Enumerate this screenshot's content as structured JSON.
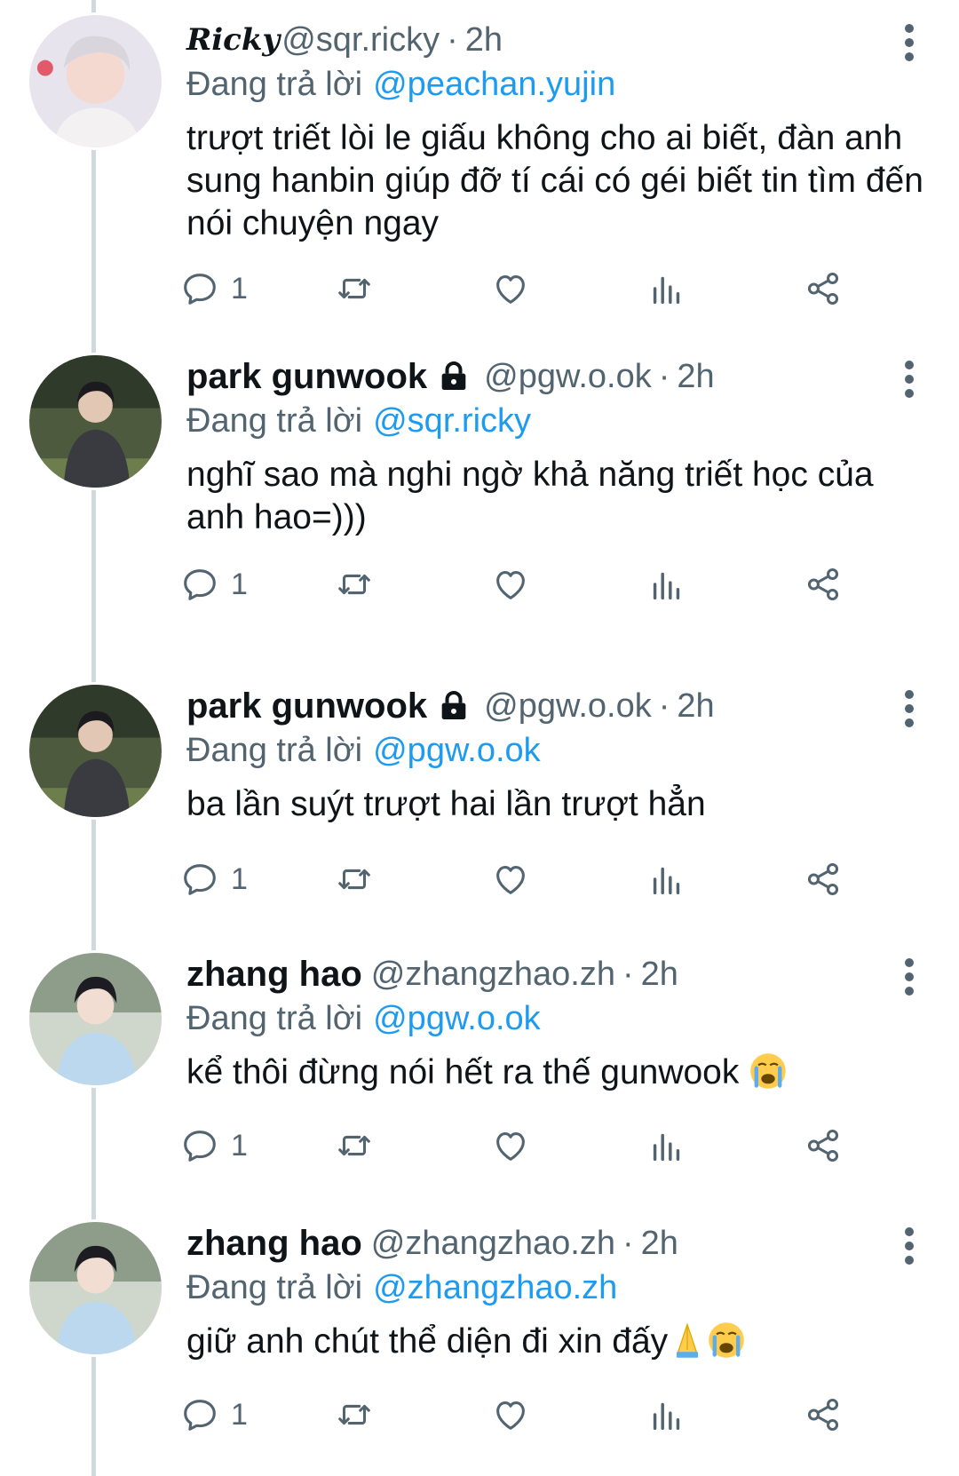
{
  "tweets": [
    {
      "name": "Ricky",
      "handle": "@sqr.ricky",
      "sep": "·",
      "time": "2h",
      "reply_label": "Đang trả lời",
      "reply_to": "@peachan.yujin",
      "text": "trượt triết lòi le giấu không cho ai biết, đàn anh sung hanbin giúp đỡ tí cái có géi biết tin tìm đến nói chuyện ngay",
      "reply_count": "1",
      "locked": false
    },
    {
      "name": "park gunwook",
      "handle": "@pgw.o.ok",
      "sep": "·",
      "time": "2h",
      "reply_label": "Đang trả lời",
      "reply_to": "@sqr.ricky",
      "text": "nghĩ sao mà nghi ngờ khả năng triết học của anh hao=)))",
      "reply_count": "1",
      "locked": true
    },
    {
      "name": "park gunwook",
      "handle": "@pgw.o.ok",
      "sep": "·",
      "time": "2h",
      "reply_label": "Đang trả lời",
      "reply_to": "@pgw.o.ok",
      "text": "ba lần suýt trượt hai lần trượt hẳn",
      "reply_count": "1",
      "locked": true
    },
    {
      "name": "zhang hao",
      "handle": "@zhangzhao.zh",
      "sep": "·",
      "time": "2h",
      "reply_label": "Đang trả lời",
      "reply_to": "@pgw.o.ok",
      "text": "kể thôi đừng nói hết ra thế gunwook ",
      "reply_count": "1",
      "locked": false
    },
    {
      "name": "zhang hao",
      "handle": "@zhangzhao.zh",
      "sep": "·",
      "time": "2h",
      "reply_label": "Đang trả lời",
      "reply_to": "@zhangzhao.zh",
      "text": "giữ anh chút thể diện đi xin đấy",
      "reply_count": "1",
      "locked": false
    }
  ],
  "icons": {
    "reply": "speech-bubble-icon",
    "retweet": "retweet-icon",
    "like": "heart-icon",
    "views": "bar-chart-icon",
    "share": "share-icon",
    "more": "vertical-dots-icon",
    "lock": "lock-icon"
  },
  "colors": {
    "link": "#1d9bf0",
    "secondary": "#536471",
    "thread_line": "#cfd9de"
  }
}
